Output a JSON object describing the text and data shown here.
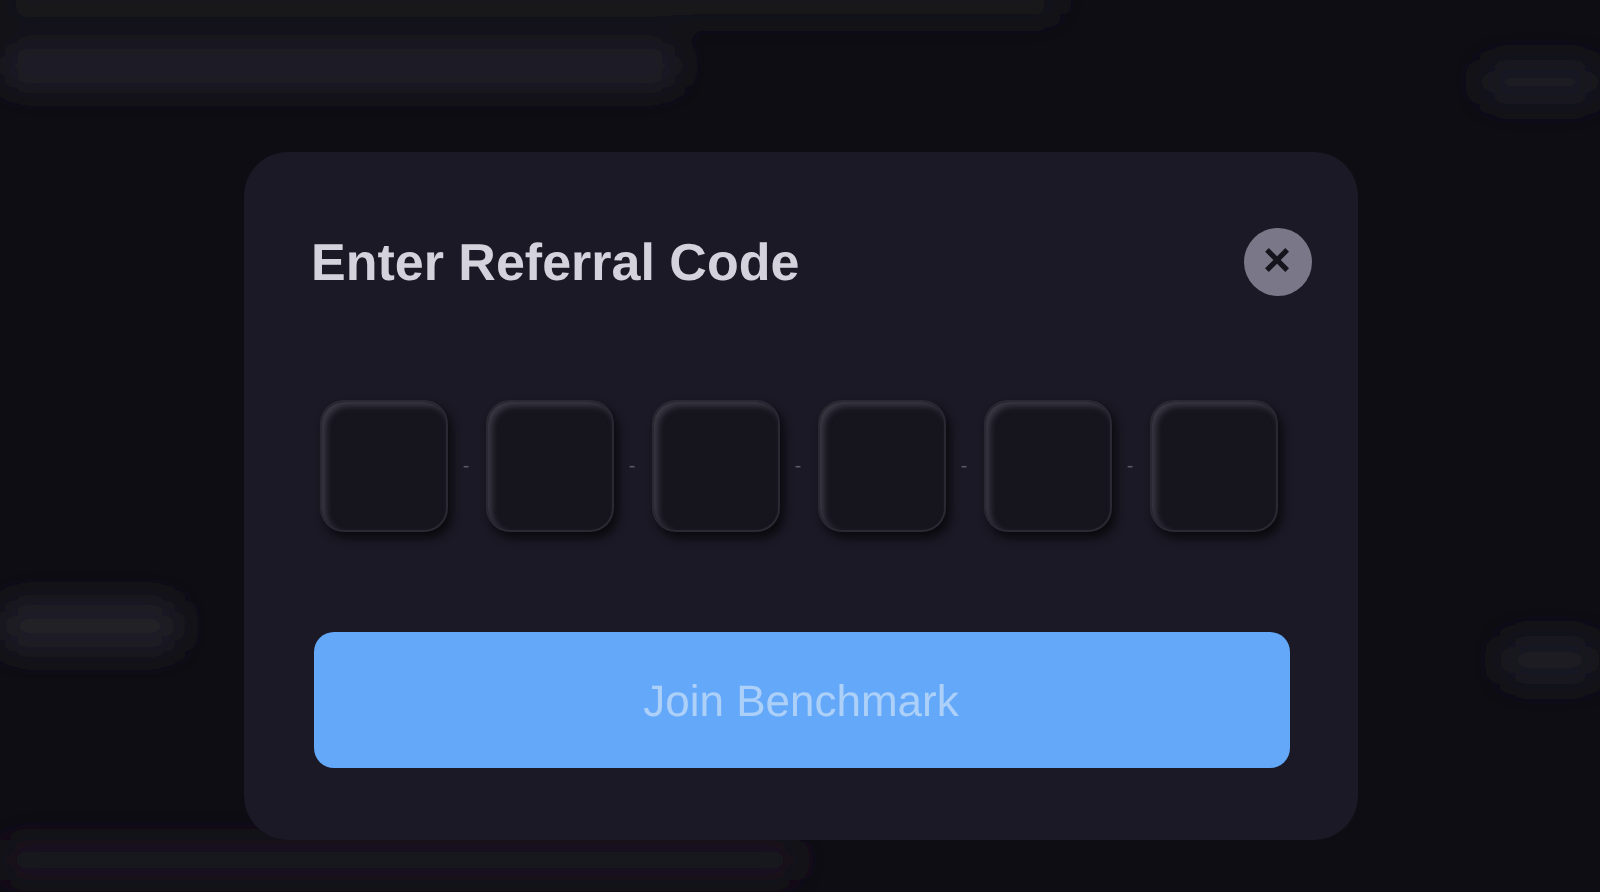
{
  "dialog": {
    "title": "Enter Referral Code",
    "close_label": "×",
    "code_fields": [
      {
        "kind": "digit"
      },
      {
        "kind": "digit"
      },
      {
        "kind": "digit"
      },
      {
        "kind": "digit"
      },
      {
        "kind": "digit"
      },
      {
        "kind": "digit"
      }
    ],
    "separators": [
      "-",
      "-",
      "-",
      "-",
      "-"
    ],
    "submit": {
      "label": "Join Benchmark",
      "disabled": true
    }
  }
}
